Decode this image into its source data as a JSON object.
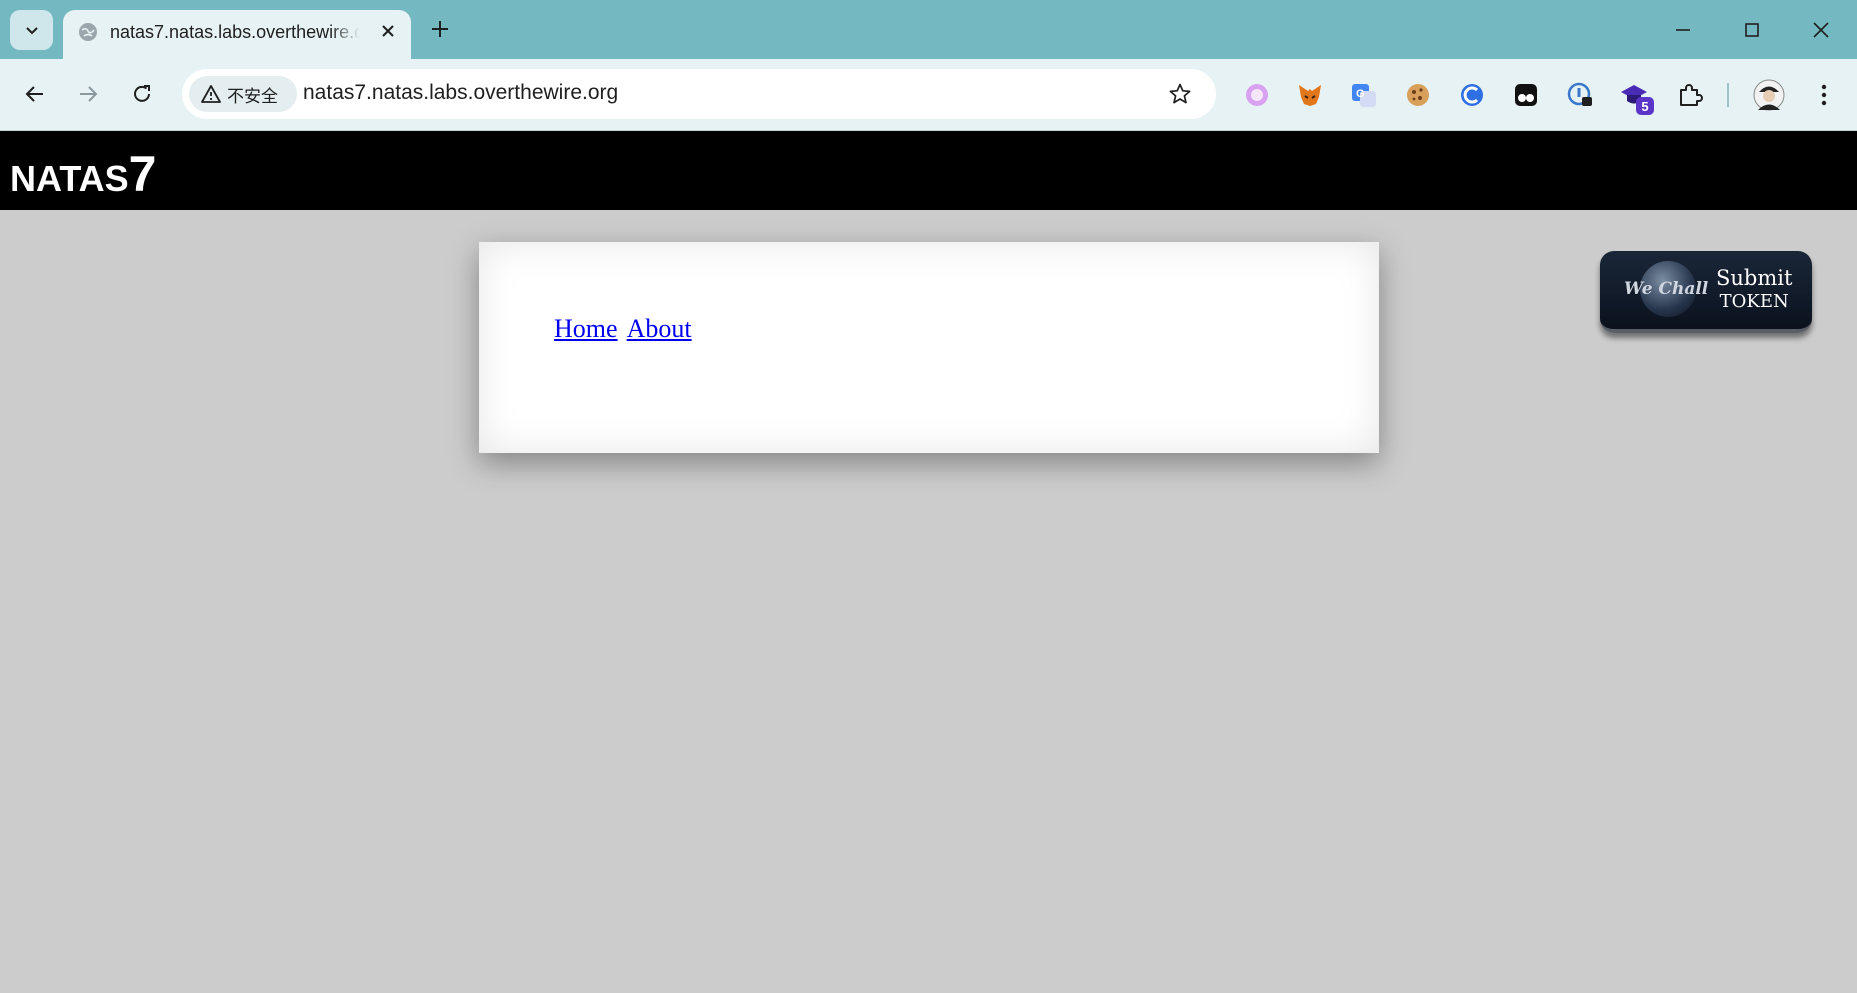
{
  "browser": {
    "tab": {
      "title": "natas7.natas.labs.overthewire.org"
    },
    "address_bar": {
      "security_label": "不安全",
      "url": "natas7.natas.labs.overthewire.org"
    },
    "extensions": [
      {
        "name": "circle-extension-icon"
      },
      {
        "name": "metamask-fox-icon"
      },
      {
        "name": "google-translate-icon"
      },
      {
        "name": "cookie-icon"
      },
      {
        "name": "blue-circle-extension-icon"
      },
      {
        "name": "tampermonkey-icon"
      },
      {
        "name": "password-manager-icon"
      },
      {
        "name": "graduation-cap-extension-icon",
        "badge": "5"
      },
      {
        "name": "puzzle-extensions-icon"
      }
    ],
    "colors": {
      "tabstrip": "#74b9c1",
      "toolbar": "#e6f2f3"
    }
  },
  "page": {
    "logo": {
      "name": "NATAS",
      "number": "7"
    },
    "nav": {
      "home": "Home",
      "about": "About"
    },
    "wechall": {
      "logo_text": "We Chall",
      "submit_line1": "Submit",
      "submit_line2": "TOKEN"
    },
    "colors": {
      "background": "#cccccc",
      "header": "#000000",
      "link": "#0000ee"
    }
  }
}
